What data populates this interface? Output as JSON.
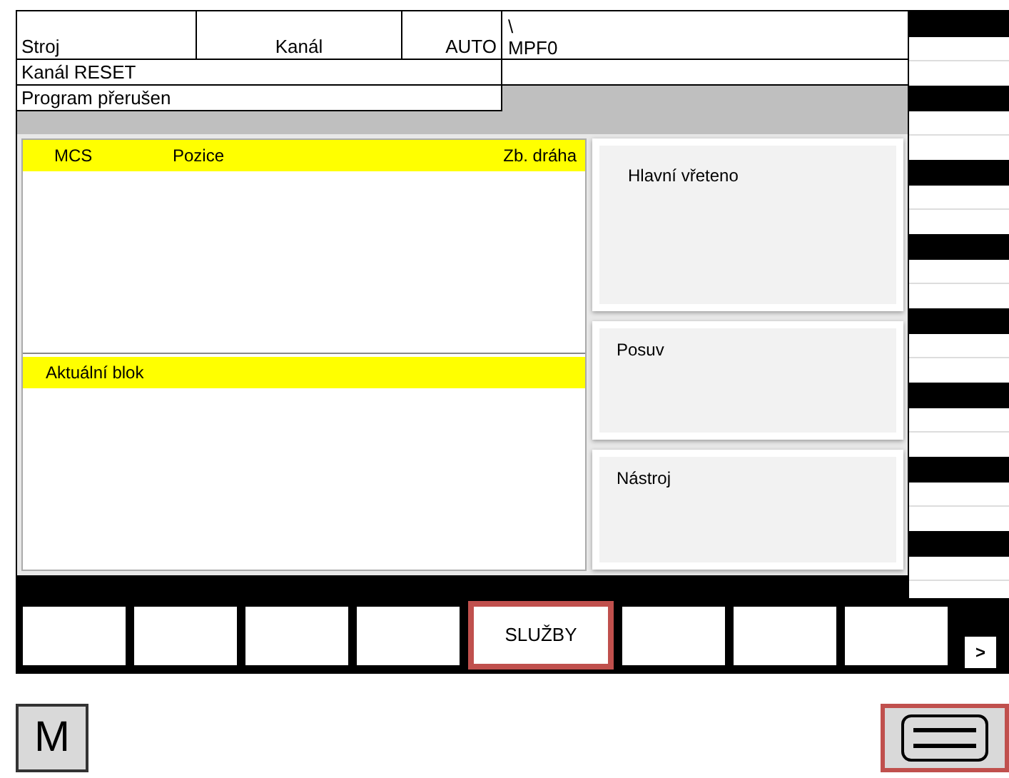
{
  "header": {
    "machine": "Stroj",
    "channel": "Kanál",
    "mode": "AUTO",
    "path": "\\",
    "program": "MPF0"
  },
  "status_lines": [
    "Kanál RESET",
    "Program přerušen"
  ],
  "position_panel": {
    "columns": [
      "MCS",
      "Pozice",
      "Zb. dráha"
    ]
  },
  "block_panel": {
    "title": "Aktuální blok"
  },
  "side_cards": [
    {
      "title": "Hlavní vřeteno"
    },
    {
      "title": "Posuv"
    },
    {
      "title": "Nástroj"
    }
  ],
  "horizontal_softkeys": [
    {
      "selected": false
    },
    {
      "selected": false
    },
    {
      "selected": false
    },
    {
      "selected": false
    },
    {
      "label": "SLUŽBY",
      "selected": true
    },
    {
      "selected": false
    },
    {
      "selected": false
    },
    {
      "selected": false
    }
  ],
  "more_key": ">",
  "machine_button": "M",
  "menu_button": {
    "highlighted": true
  }
}
